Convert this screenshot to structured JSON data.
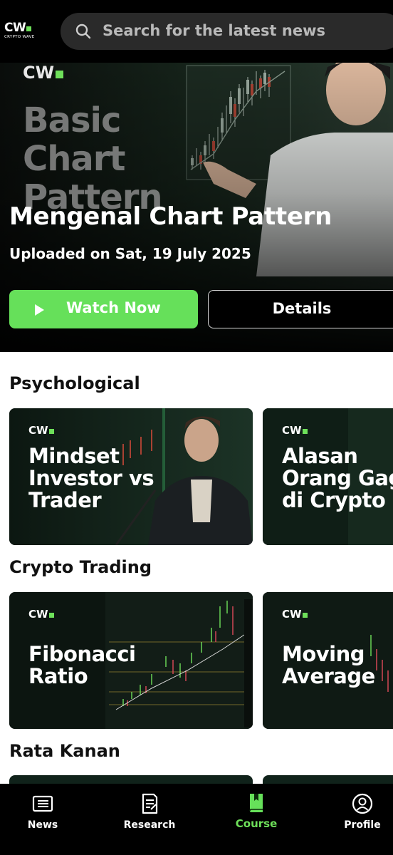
{
  "header": {
    "logo_mark": "CW",
    "logo_sub": "CRYPTO WAVE",
    "search_placeholder": "Search for the latest news",
    "search_icon": "search-icon"
  },
  "hero": {
    "thumb_logo": "CW",
    "thumb_lines": [
      "Basic",
      "Chart",
      "Pattern"
    ],
    "title": "Mengenal Chart Pattern",
    "uploaded": "Uploaded on Sat, 19 July 2025",
    "watch_label": "Watch Now",
    "details_label": "Details"
  },
  "sections": [
    {
      "title": "Psychological",
      "cards": [
        {
          "logo": "CW",
          "lines": [
            "Mindset",
            "Investor vs",
            "Trader"
          ]
        },
        {
          "logo": "CW",
          "lines": [
            "Alasan",
            "Orang Gagal",
            "di Crypto"
          ]
        }
      ]
    },
    {
      "title": "Crypto Trading",
      "cards": [
        {
          "logo": "CW",
          "lines": [
            "Fibonacci",
            "Ratio"
          ]
        },
        {
          "logo": "CW",
          "lines": [
            "Moving",
            "Average"
          ]
        }
      ]
    },
    {
      "title": "Rata Kanan",
      "cards": []
    }
  ],
  "nav": [
    {
      "label": "News",
      "icon": "newspaper-icon",
      "active": false
    },
    {
      "label": "Research",
      "icon": "document-icon",
      "active": false
    },
    {
      "label": "Course",
      "icon": "book-icon",
      "active": true
    },
    {
      "label": "Profile",
      "icon": "profile-icon",
      "active": false
    }
  ],
  "colors": {
    "accent": "#66e05a",
    "background": "#ffffff",
    "bars": "#000000"
  }
}
